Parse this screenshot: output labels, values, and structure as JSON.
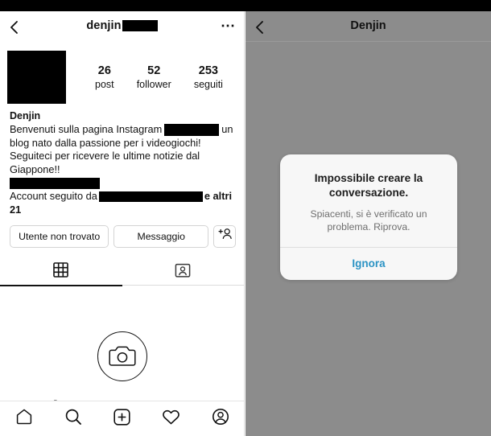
{
  "left_panel": {
    "header": {
      "back_icon": "back-chevron-icon",
      "username": "denjin",
      "username_redacted": true,
      "more_icon": "more-options-icon"
    },
    "profile": {
      "avatar_redacted": true,
      "stats": [
        {
          "value": "26",
          "label": "post"
        },
        {
          "value": "52",
          "label": "follower"
        },
        {
          "value": "253",
          "label": "seguiti"
        }
      ],
      "display_name": "Denjin",
      "bio_part1": "Benvenuti sulla pagina Instagram",
      "bio_part2": "un blog nato dalla passione per i videogiochi! Seguiteci per ricevere le ultime notizie dal Giappone!!",
      "followed_by_prefix": "Account seguito da",
      "followed_by_suffix": "e altri 21"
    },
    "actions": {
      "follow_label": "Utente non trovato",
      "message_label": "Messaggio",
      "adduser_icon": "add-user-icon"
    },
    "tabs": [
      {
        "icon": "grid-icon",
        "name": "tab-grid",
        "active": true
      },
      {
        "icon": "tagged-portrait-icon",
        "name": "tab-tagged",
        "active": false
      }
    ],
    "empty_state": {
      "icon": "camera-icon",
      "title": "Ancora nessun post"
    },
    "bottom_nav": [
      {
        "icon": "home-icon",
        "name": "nav-home"
      },
      {
        "icon": "search-icon",
        "name": "nav-search"
      },
      {
        "icon": "add-post-icon",
        "name": "nav-add"
      },
      {
        "icon": "heart-icon",
        "name": "nav-activity"
      },
      {
        "icon": "profile-icon",
        "name": "nav-profile"
      }
    ]
  },
  "right_panel": {
    "header": {
      "back_icon": "back-chevron-icon",
      "title": "Denjin"
    },
    "dialog": {
      "title": "Impossibile creare la conversazione.",
      "message": "Spiacenti, si è verificato un problema. Riprova.",
      "action_label": "Ignora",
      "action_color": "#2b93c4"
    }
  }
}
